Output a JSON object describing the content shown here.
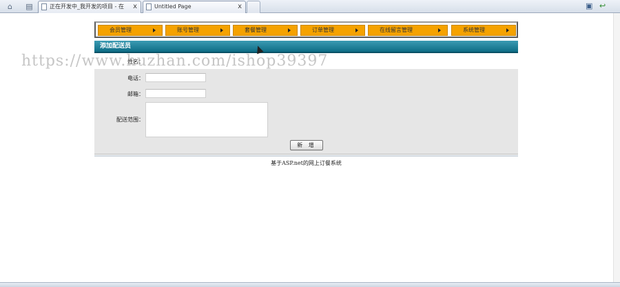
{
  "browser": {
    "tabs": [
      {
        "title": "正在开发中_我开发的项目 - 在"
      },
      {
        "title": "Untitled Page"
      }
    ],
    "close_glyph": "x",
    "icons": [
      "home-icon",
      "document-icon",
      "page-icon",
      "print-icon",
      "back-arrow-icon"
    ]
  },
  "nav": {
    "items": [
      {
        "label": "会员管理"
      },
      {
        "label": "账号管理"
      },
      {
        "label": "套餐管理"
      },
      {
        "label": "订单管理"
      },
      {
        "label": "在线留言管理"
      },
      {
        "label": "系统管理"
      }
    ],
    "color": "#f5a200"
  },
  "panel": {
    "title": "添加配送员",
    "fields": {
      "name_label": "姓名：",
      "phone_label": "电话：",
      "email_label": "邮箱：",
      "area_label": "配送范围：",
      "name_value": "",
      "phone_value": "",
      "email_value": "",
      "area_value": ""
    },
    "submit_label": "新 增",
    "header_color": "#0e6d86"
  },
  "footer": {
    "text": "基于ASP.net的网上订餐系统"
  },
  "watermark": "https://www.huzhan.com/ishop39397"
}
